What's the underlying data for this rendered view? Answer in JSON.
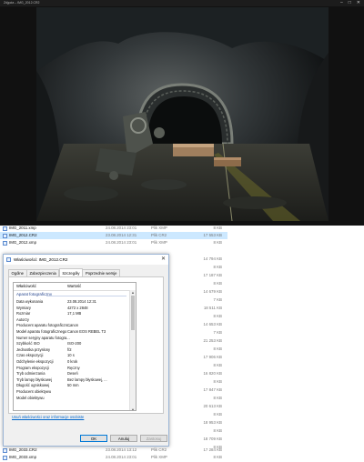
{
  "viewer": {
    "title": "Zdjęcia – IMG_2012.CR2",
    "minimize_glyph": "–",
    "maximize_glyph": "□",
    "close_glyph": "✕"
  },
  "files_above": [
    {
      "name": "IMG_2011.xmp",
      "date": "24.08.2014 23:01",
      "type": "Plik XMP",
      "size": "8 KB"
    },
    {
      "name": "IMG_2012.CR2",
      "date": "23.08.2014 12:31",
      "type": "Plik CR2",
      "size": "17 553 KB"
    },
    {
      "name": "IMG_2012.xmp",
      "date": "24.08.2014 23:01",
      "type": "Plik XMP",
      "size": "8 KB"
    }
  ],
  "files_below": [
    {
      "name": "IMG_2033.CR2",
      "date": "23.08.2014 13:12",
      "type": "Plik CR2",
      "size": "17 284 KB"
    },
    {
      "name": "IMG_2033.xmp",
      "date": "24.08.2014 23:01",
      "type": "Plik XMP",
      "size": "8 KB"
    }
  ],
  "size_column": [
    "14 794 KB",
    "8 KB",
    "17 187 KB",
    "8 KB",
    "14 679 KB",
    "7 KB",
    "18 511 KB",
    "8 KB",
    "14 653 KB",
    "7 KB",
    "21 253 KB",
    "8 KB",
    "17 906 KB",
    "8 KB",
    "16 820 KB",
    "8 KB",
    "17 847 KB",
    "8 KB",
    "20 613 KB",
    "8 KB",
    "18 953 KB",
    "8 KB",
    "18 709 KB",
    "8 KB"
  ],
  "dialog": {
    "title": "Właściwości: IMG_2012.CR2",
    "close_glyph": "✕",
    "tabs": [
      "Ogólne",
      "Zabezpieczenia",
      "Szczegóły",
      "Poprzednie wersje"
    ],
    "active_tab": 2,
    "columns": {
      "name": "Właściwość",
      "value": "Wartość"
    },
    "group_title": "Aparat fotograficzny",
    "properties": [
      {
        "name": "Data wykonania",
        "value": "23.08.2014 12:31"
      },
      {
        "name": "Wymiary",
        "value": "4272 x 2848"
      },
      {
        "name": "Rozmiar",
        "value": "17,1 MB"
      },
      {
        "name": "Autorzy",
        "value": ""
      },
      {
        "name": "Producent aparatu fotograficzn...",
        "value": "Canon"
      },
      {
        "name": "Model aparatu fotograficznego",
        "value": "Canon EOS REBEL T3"
      },
      {
        "name": "Numer seryjny aparatu fotogra...",
        "value": ""
      },
      {
        "name": "Szybkość ISO",
        "value": "ISO-200"
      },
      {
        "name": "Jednostka przysłony",
        "value": "f/2"
      },
      {
        "name": "Czas ekspozycji",
        "value": "10 s"
      },
      {
        "name": "Odchylenie ekspozycji",
        "value": "0 krok"
      },
      {
        "name": "Program ekspozycji",
        "value": "Ręczny"
      },
      {
        "name": "Tryb odmierzania",
        "value": "Deseń"
      },
      {
        "name": "Tryb lampy błyskowej",
        "value": "Bez lampy błyskowej, ..."
      },
      {
        "name": "Długość ogniskowej",
        "value": "50 mm"
      },
      {
        "name": "Producent obiektywu",
        "value": ""
      },
      {
        "name": "Model obiektywu",
        "value": ""
      }
    ],
    "remove_link": "Usuń właściwości oraz informacje osobiste",
    "buttons": {
      "ok": "OK",
      "cancel": "Anuluj",
      "apply": "Zastosuj"
    },
    "scroll_up_glyph": "▲",
    "scroll_down_glyph": "▼"
  }
}
